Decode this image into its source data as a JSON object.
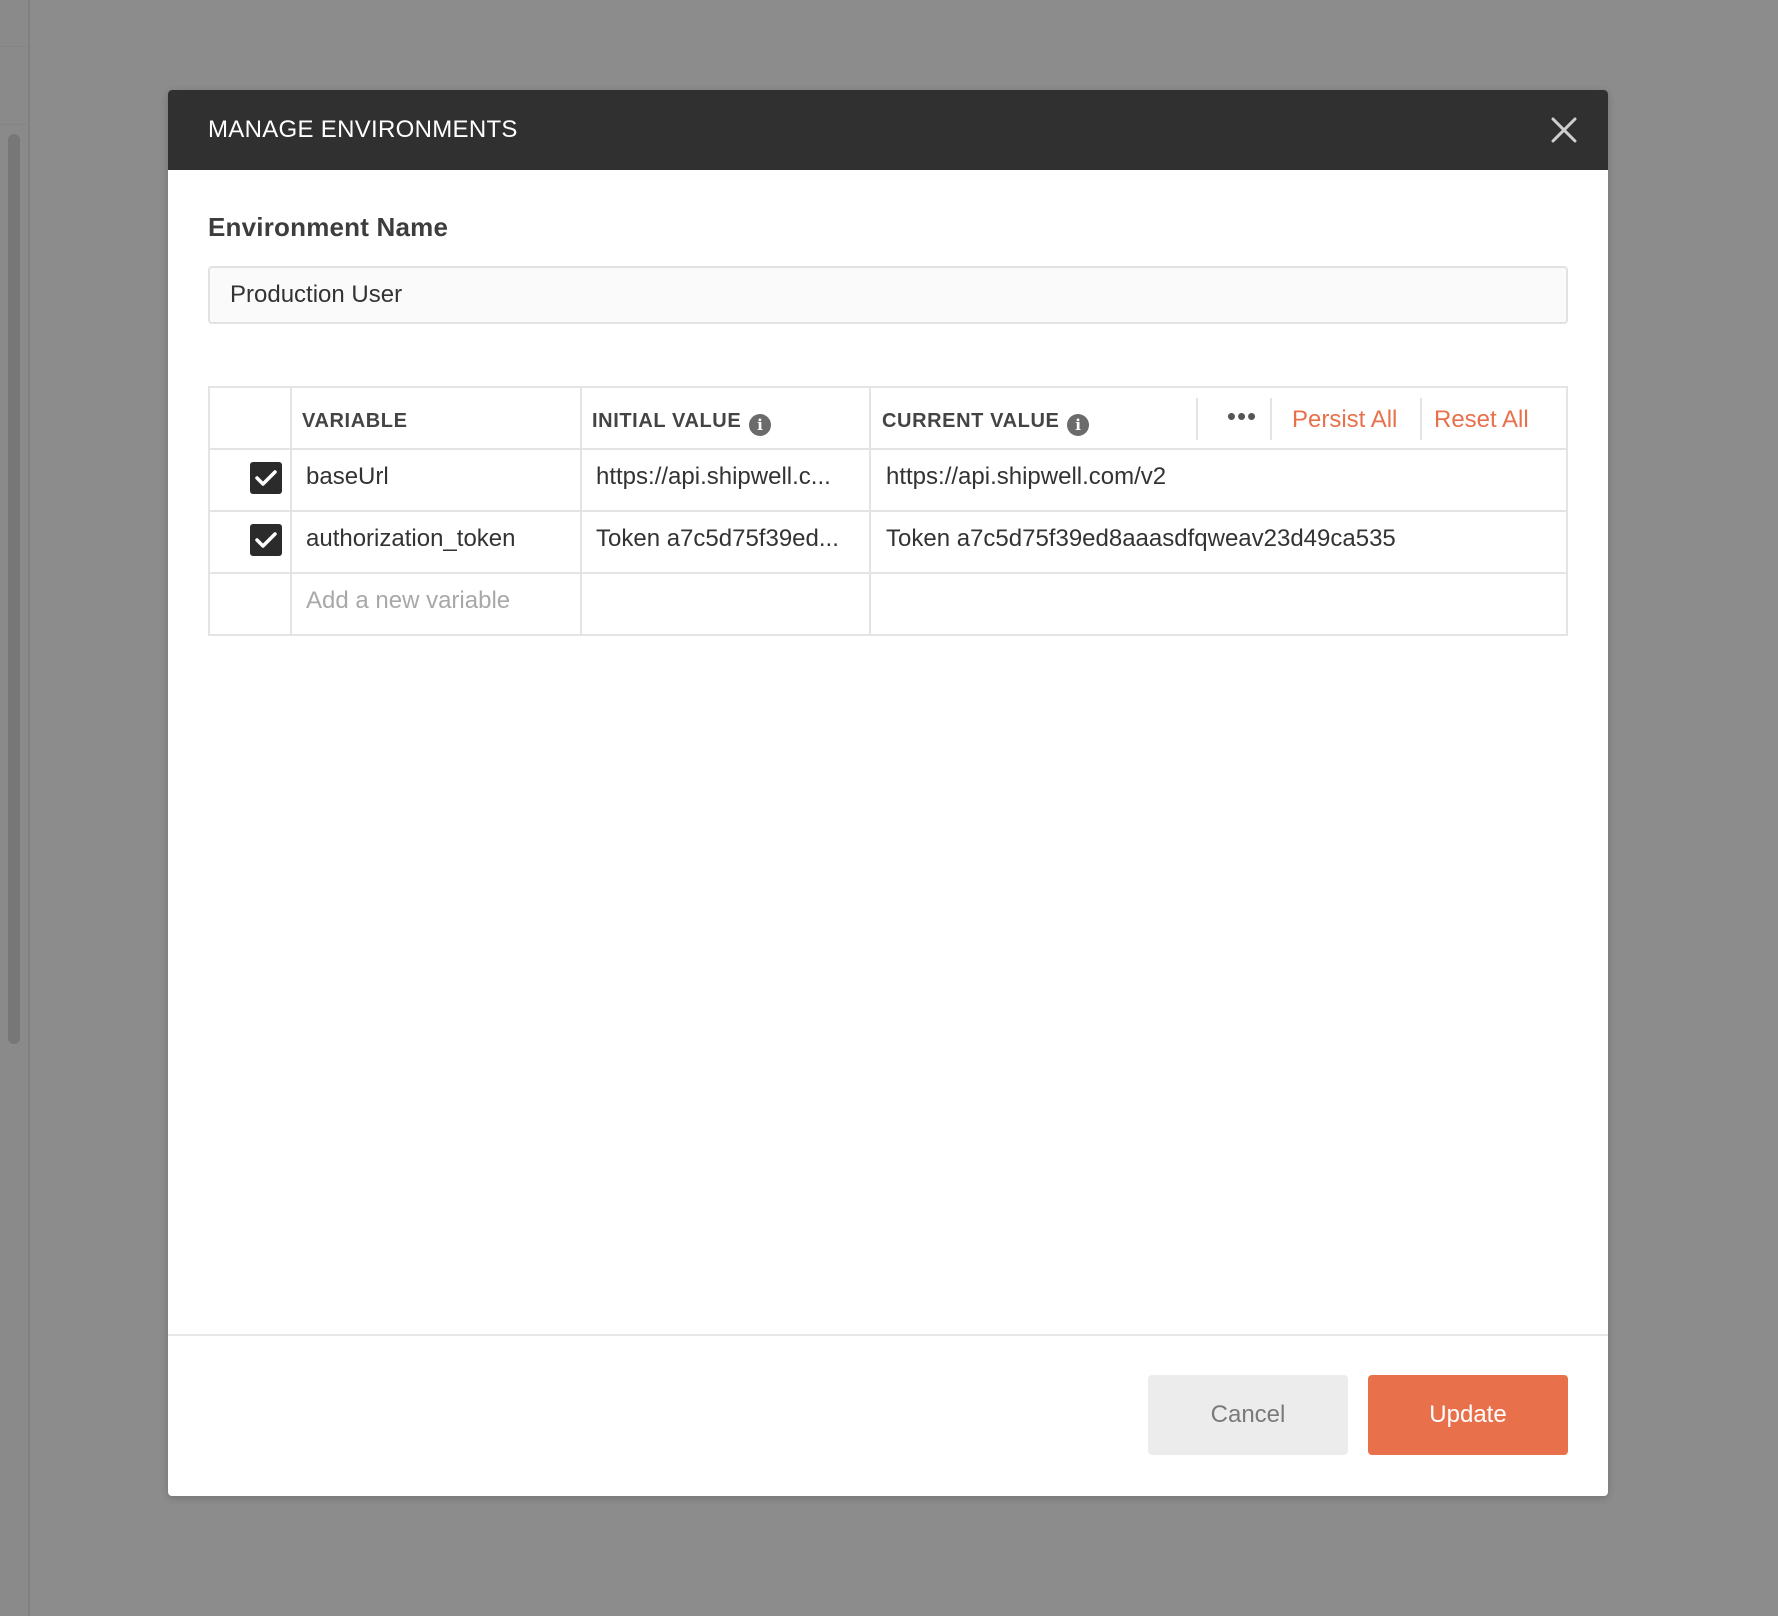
{
  "modal": {
    "title": "MANAGE ENVIRONMENTS",
    "close_icon": "close-icon"
  },
  "environment": {
    "label": "Environment Name",
    "value": "Production User"
  },
  "table": {
    "headers": {
      "variable": "VARIABLE",
      "initial_value": "INITIAL VALUE",
      "current_value": "CURRENT VALUE",
      "info_icon": "info-icon",
      "more_icon": "•••",
      "persist_all": "Persist All",
      "reset_all": "Reset All"
    },
    "rows": [
      {
        "checked": true,
        "variable": "baseUrl",
        "initial_value": "https://api.shipwell.c...",
        "current_value": "https://api.shipwell.com/v2"
      },
      {
        "checked": true,
        "variable": "authorization_token",
        "initial_value": "Token a7c5d75f39ed...",
        "current_value": "Token a7c5d75f39ed8aaasdfqweav23d49ca535"
      }
    ],
    "new_row_placeholder": "Add a new variable"
  },
  "footer": {
    "cancel_label": "Cancel",
    "update_label": "Update"
  },
  "colors": {
    "accent": "#e8714b",
    "header_bg": "#303030",
    "overlay": "#8c8c8c"
  }
}
